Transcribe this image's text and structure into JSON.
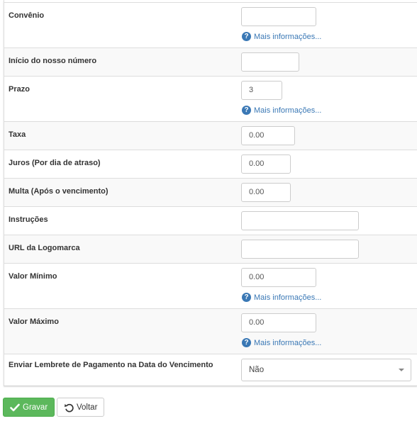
{
  "form": {
    "rows": [
      {
        "label": "Convênio",
        "value": "",
        "help": "Mais informações..."
      },
      {
        "label": "Início do nosso número",
        "value": ""
      },
      {
        "label": "Prazo",
        "value": "3",
        "help": "Mais informações..."
      },
      {
        "label": "Taxa",
        "value": "0.00"
      },
      {
        "label": "Juros (Por dia de atraso)",
        "value": "0.00"
      },
      {
        "label": "Multa (Após o vencimento)",
        "value": "0.00"
      },
      {
        "label": "Instruções",
        "value": ""
      },
      {
        "label": "URL da Logomarca",
        "value": ""
      },
      {
        "label": "Valor Mínimo",
        "value": "0.00",
        "help": "Mais informações..."
      },
      {
        "label": "Valor Máximo",
        "value": "0.00",
        "help": "Mais informações..."
      },
      {
        "label": "Enviar Lembrete de Pagamento na Data do Vencimento",
        "selected": "Não"
      }
    ]
  },
  "actions": {
    "save_label": "Gravar",
    "back_label": "Voltar"
  },
  "icons": {
    "help": "question-circle-icon",
    "save": "check-icon",
    "back": "undo-icon"
  },
  "colors": {
    "link": "#3a78b5",
    "success": "#5cb85c",
    "row_shade": "#f9f9f9",
    "border": "#dddddd"
  }
}
